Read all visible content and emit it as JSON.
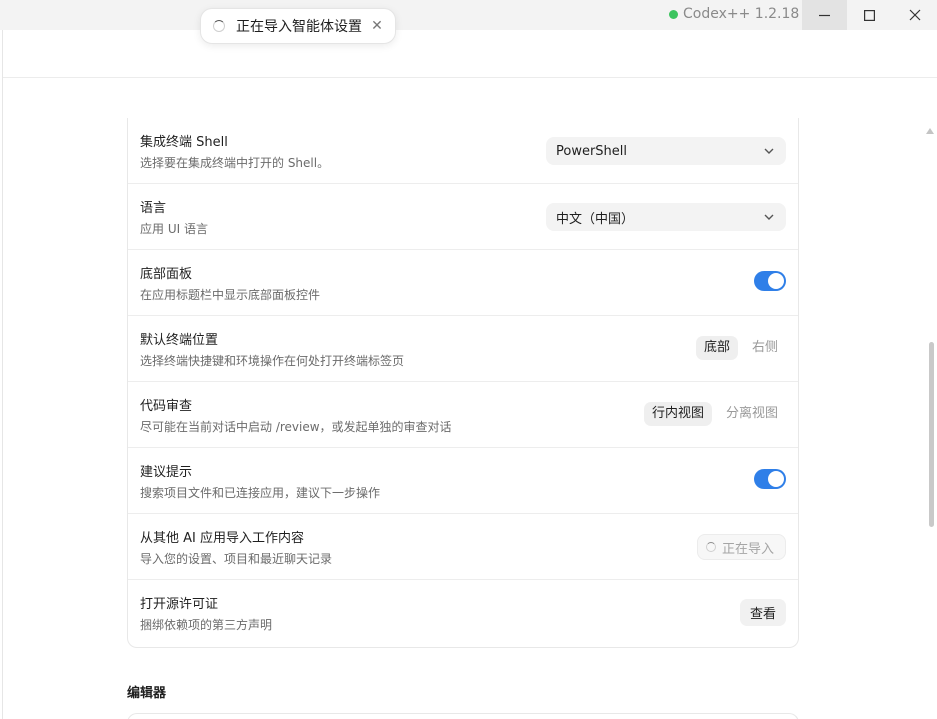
{
  "window": {
    "app_title": "Codex++ 1.2.18",
    "status_color": "#3cc45f"
  },
  "toast": {
    "text": "正在导入智能体设置",
    "close_glyph": "✕"
  },
  "settings": {
    "rows": [
      {
        "title": "集成终端 Shell",
        "desc": "选择要在集成终端中打开的 Shell。",
        "control": "select",
        "value": "PowerShell"
      },
      {
        "title": "语言",
        "desc": "应用 UI 语言",
        "control": "select",
        "value": "中文（中国）"
      },
      {
        "title": "底部面板",
        "desc": "在应用标题栏中显示底部面板控件",
        "control": "toggle",
        "on": true
      },
      {
        "title": "默认终端位置",
        "desc": "选择终端快捷键和环境操作在何处打开终端标签页",
        "control": "segmented",
        "options": [
          "底部",
          "右侧"
        ],
        "selected": "底部"
      },
      {
        "title": "代码审查",
        "desc": "尽可能在当前对话中启动 /review，或发起单独的审查对话",
        "control": "segmented",
        "options": [
          "行内视图",
          "分离视图"
        ],
        "selected": "行内视图"
      },
      {
        "title": "建议提示",
        "desc": "搜索项目文件和已连接应用，建议下一步操作",
        "control": "toggle",
        "on": true
      },
      {
        "title": "从其他 AI 应用导入工作内容",
        "desc": "导入您的设置、项目和最近聊天记录",
        "control": "status",
        "value": "正在导入"
      },
      {
        "title": "打开源许可证",
        "desc": "捆绑依赖项的第三方声明",
        "control": "button",
        "value": "查看"
      }
    ]
  },
  "section": {
    "title": "编辑器"
  },
  "colors": {
    "accent": "#2f7fe8",
    "toggle_on": "#2f7fe8"
  }
}
